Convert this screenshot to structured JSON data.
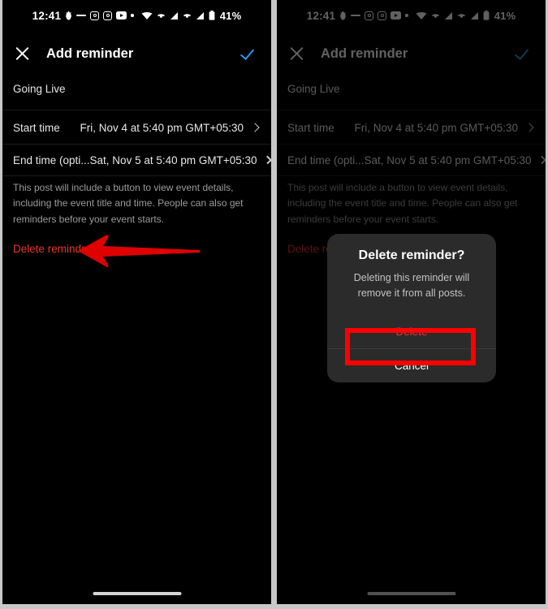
{
  "statusbar": {
    "time": "12:41",
    "battery_percent": "41%",
    "icons": [
      "alarm-icon",
      "dash-icon",
      "instagram-icon",
      "instagram-icon",
      "youtube-icon",
      "dot-icon",
      "wifi-icon",
      "missed-call-icon",
      "signal-icon",
      "missed-call-icon",
      "signal-icon",
      "battery-icon"
    ]
  },
  "appbar": {
    "close_icon": "close-icon",
    "title": "Add reminder",
    "confirm_icon": "check-icon",
    "accent_color": "#1d9bf0"
  },
  "form": {
    "section_title": "Going Live",
    "rows": [
      {
        "label": "Start time",
        "value": "Fri, Nov 4 at 5:40 pm GMT+05:30",
        "trailing_icon": "chevron-right-icon"
      },
      {
        "label": "End time (opti...",
        "value": "Sat, Nov 5 at 5:40 pm GMT+05:30",
        "trailing_icon": "close-icon"
      }
    ],
    "helper_text": "This post will include a button to view event details, including the event title and time. People can also get reminders before your event starts.",
    "delete_link": "Delete reminder",
    "delete_color": "#e8352b"
  },
  "dialog": {
    "title": "Delete reminder?",
    "message": "Deleting this reminder will remove it from all posts.",
    "delete_label": "Delete",
    "cancel_label": "Cancel",
    "delete_color": "#e8352b"
  },
  "annotations": {
    "highlight_color": "#ff0000",
    "arrow_target": "Delete reminder",
    "box_target": "Delete"
  }
}
